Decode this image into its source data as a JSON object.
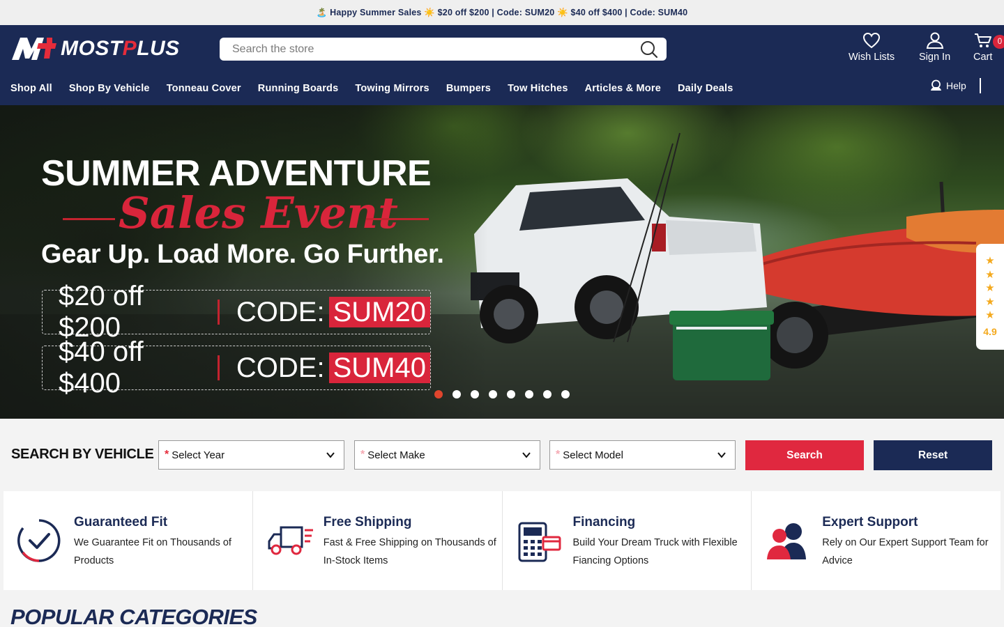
{
  "promo": {
    "text": "🏝️ Happy Summer Sales ☀️ $20 off $200 | Code: SUM20 ☀️ $40 off $400 | Code: SUM40"
  },
  "header": {
    "logo_text_a": "MOST",
    "logo_text_p": "P",
    "logo_text_b": "LUS",
    "search_placeholder": "Search the store",
    "wishlist_label": "Wish Lists",
    "signin_label": "Sign In",
    "cart_label": "Cart",
    "cart_count": "0",
    "help_label": "Help"
  },
  "nav": [
    "Shop All",
    "Shop By Vehicle",
    "Tonneau Cover",
    "Running Boards",
    "Towing Mirrors",
    "Bumpers",
    "Tow Hitches",
    "Articles & More",
    "Daily Deals"
  ],
  "hero": {
    "title": "SUMMER ADVENTURE",
    "script": "Sales Event",
    "subtitle": "Gear Up. Load More. Go Further.",
    "offers": [
      {
        "amount": "$20 off $200",
        "label": "CODE:",
        "code": "SUM20"
      },
      {
        "amount": "$40 off $400",
        "label": "CODE:",
        "code": "SUM40"
      }
    ],
    "slide_count": 8,
    "active_slide": 1
  },
  "rating": {
    "stars": 5,
    "score": "4.9"
  },
  "vehicle_search": {
    "title": "SEARCH BY VEHICLE",
    "year_placeholder": "Select Year",
    "make_placeholder": "Select Make",
    "model_placeholder": "Select Model",
    "search_label": "Search",
    "reset_label": "Reset"
  },
  "features": [
    {
      "title": "Guaranteed Fit",
      "desc": "We Guarantee Fit on Thousands of Products",
      "icon": "checkmark-circle-icon"
    },
    {
      "title": "Free Shipping",
      "desc": "Fast & Free Shipping on Thousands of In-Stock Items",
      "icon": "delivery-truck-icon"
    },
    {
      "title": "Financing",
      "desc": "Build Your Dream Truck with Flexible Fiancing Options",
      "icon": "payment-terminal-icon"
    },
    {
      "title": "Expert Support",
      "desc": "Rely on Our Expert Support Team for Advice",
      "icon": "support-team-icon"
    }
  ],
  "section_title": "POPULAR CATEGORIES",
  "colors": {
    "navy": "#1b2a55",
    "red": "#d9253b",
    "star": "#f4a91d"
  }
}
